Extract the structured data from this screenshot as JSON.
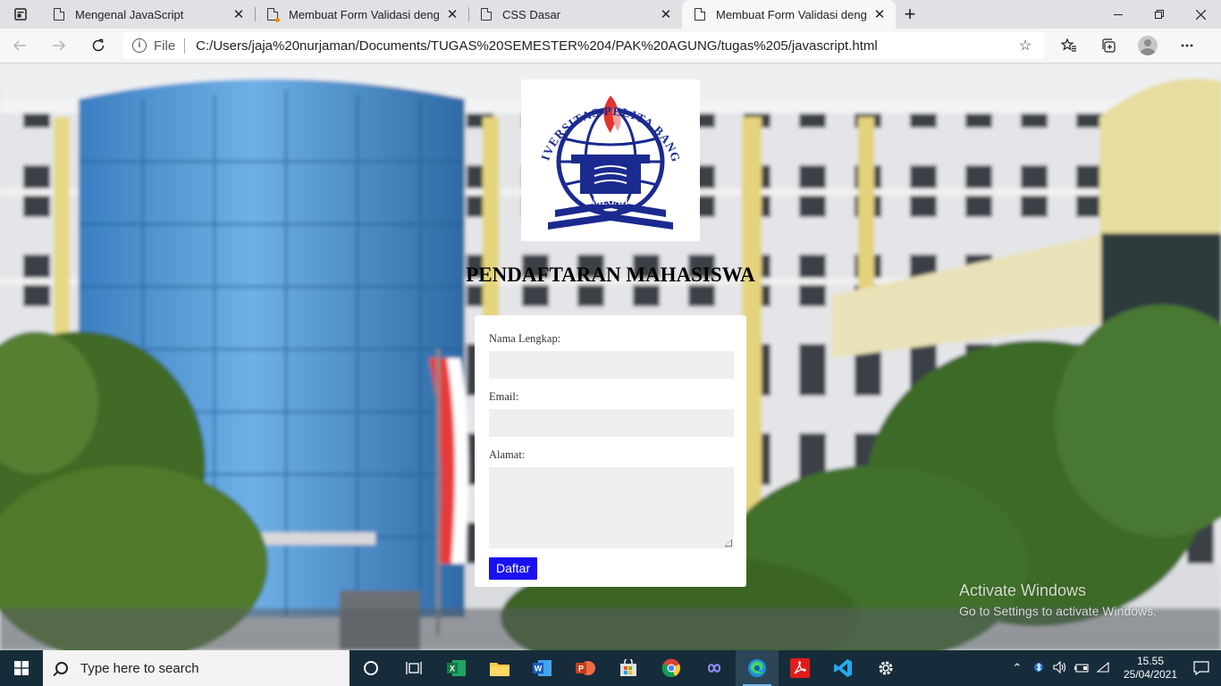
{
  "browser": {
    "tabs": [
      {
        "title": "Mengenal JavaScript",
        "active": false
      },
      {
        "title": "Membuat Form Validasi dengan",
        "active": false,
        "loading_dot": true
      },
      {
        "title": "CSS Dasar",
        "active": false
      },
      {
        "title": "Membuat Form Validasi dengan",
        "active": true
      }
    ],
    "address": {
      "scheme_label": "File",
      "url": "C:/Users/jaja%20nurjaman/Documents/TUGAS%20SEMESTER%204/PAK%20AGUNG/tugas%205/javascript.html"
    }
  },
  "page": {
    "logo": {
      "top_text": "UNIVERSITAS PELITA BANGSA",
      "bottom_text": "MEGAH",
      "colors": {
        "blue": "#1b2a8f",
        "red": "#e5322d"
      }
    },
    "heading": "PENDAFTARAN MAHASISWA",
    "form": {
      "name_label": "Nama Lengkap:",
      "email_label": "Email:",
      "address_label": "Alamat:",
      "submit_label": "Daftar"
    },
    "watermark": {
      "title": "Activate Windows",
      "subtitle": "Go to Settings to activate Windows."
    }
  },
  "taskbar": {
    "search_placeholder": "Type here to search",
    "time": "15.55",
    "date": "25/04/2021"
  },
  "colors": {
    "accent_button": "#1a10f0",
    "taskbar": "#172c3a",
    "tab_strip": "#dfe1e5"
  }
}
